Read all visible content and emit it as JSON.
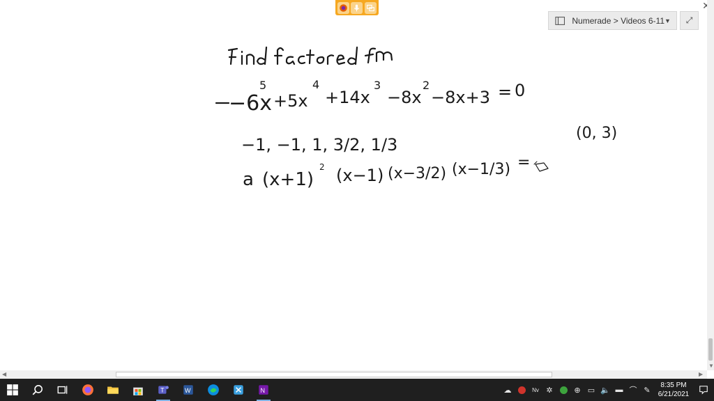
{
  "notebook": {
    "label": "Numerade > Videos 6-11"
  },
  "handwriting": {
    "line1": "Find factored form",
    "equation": {
      "t1": "−6x",
      "e1": "5",
      "t2": "+5x",
      "e2": "4",
      "t3": "+14x",
      "e3": "3",
      "t4": "−8x",
      "e4": "2",
      "t5": "−8x+3",
      "eq": "=",
      "rhs": "0"
    },
    "roots": "−1, −1, 1, 3/2, 1/3",
    "point": "(0, 3)",
    "factored": {
      "a": "a",
      "f1": "(x+1)",
      "f1e": "2",
      "f2": "(x−1)",
      "f3": "(x−3/2)",
      "f4": "(x−1/3)",
      "eq": "="
    }
  },
  "taskbar": {
    "time": "8:35 PM",
    "date": "6/21/2021",
    "apps": [
      "windows-start",
      "search",
      "task-view",
      "firefox",
      "file-explorer",
      "microsoft-store",
      "teams",
      "word",
      "edge",
      "snipping-tool",
      "onenote"
    ]
  },
  "colors": {
    "recorder": "#f6a821",
    "taskbar": "#1f1f1f",
    "ink": "#1a1a1a"
  }
}
